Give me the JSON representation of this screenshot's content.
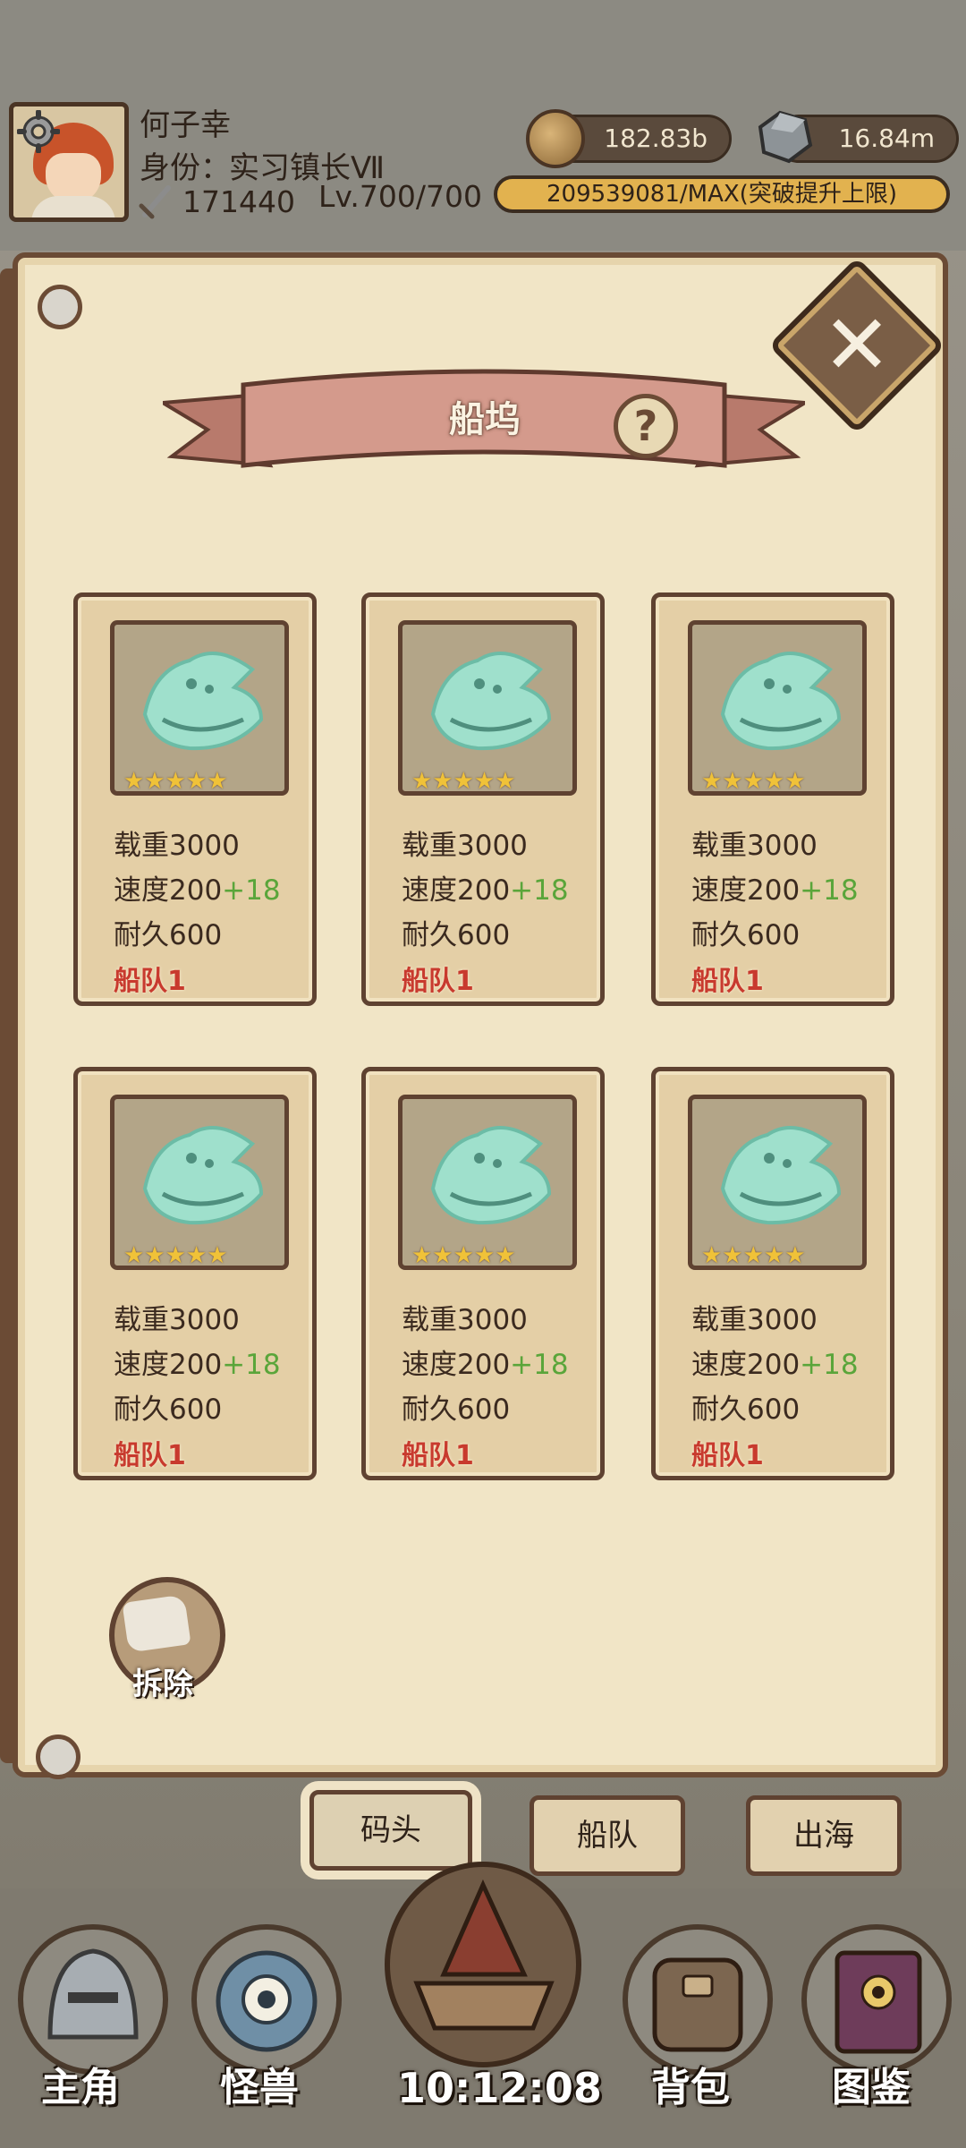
{
  "player": {
    "name": "何子幸",
    "identity_label": "身份：",
    "identity_value": "实习镇长Ⅶ",
    "level": "Lv.700/700",
    "power": "171440"
  },
  "resources": {
    "coins": "182.83b",
    "ore": "16.84m",
    "exp": "209539081/MAX(突破提升上限)"
  },
  "panel": {
    "title": "船坞",
    "help": "?",
    "close": "✕"
  },
  "cards": [
    {
      "stars": "★★★★★",
      "load": "载重3000",
      "speed": "速度200",
      "speed_bonus": "+18",
      "durability": "耐久600",
      "fleet": "船队1"
    },
    {
      "stars": "★★★★★",
      "load": "载重3000",
      "speed": "速度200",
      "speed_bonus": "+18",
      "durability": "耐久600",
      "fleet": "船队1"
    },
    {
      "stars": "★★★★★",
      "load": "载重3000",
      "speed": "速度200",
      "speed_bonus": "+18",
      "durability": "耐久600",
      "fleet": "船队1"
    },
    {
      "stars": "★★★★★",
      "load": "载重3000",
      "speed": "速度200",
      "speed_bonus": "+18",
      "durability": "耐久600",
      "fleet": "船队1"
    },
    {
      "stars": "★★★★★",
      "load": "载重3000",
      "speed": "速度200",
      "speed_bonus": "+18",
      "durability": "耐久600",
      "fleet": "船队1"
    },
    {
      "stars": "★★★★★",
      "load": "载重3000",
      "speed": "速度200",
      "speed_bonus": "+18",
      "durability": "耐久600",
      "fleet": "船队1"
    }
  ],
  "dismantle_label": "拆除",
  "tabs": {
    "dock": "码头",
    "fleet": "船队",
    "sea": "出海"
  },
  "nav": {
    "hero": "主角",
    "monster": "怪兽",
    "bag": "背包",
    "codex": "图鉴",
    "clock": "10:12:08"
  },
  "colors": {
    "parchment": "#f1e5c6",
    "card": "#e4cfa6",
    "bonus_green": "#5aa53a",
    "fleet_red": "#c83a2e",
    "ship_ghost": "#9fe0cc"
  }
}
